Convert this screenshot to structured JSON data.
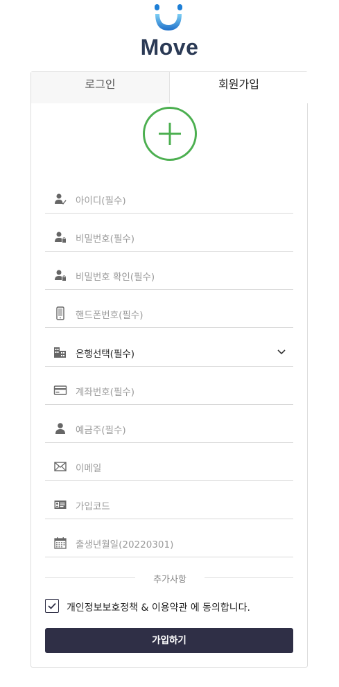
{
  "brand": {
    "name": "Move"
  },
  "tabs": [
    {
      "label": "로그인",
      "active": false
    },
    {
      "label": "회원가입",
      "active": true
    }
  ],
  "avatar_upload": {
    "icon": "plus-icon",
    "color": "#4caf50"
  },
  "fields": [
    {
      "id": "user-id",
      "icon": "user-check-icon",
      "placeholder": "아이디(필수)"
    },
    {
      "id": "password",
      "icon": "user-lock-icon",
      "placeholder": "비밀번호(필수)"
    },
    {
      "id": "password-confirm",
      "icon": "user-lock-icon",
      "placeholder": "비밀번호 확인(필수)"
    },
    {
      "id": "phone",
      "icon": "smartphone-icon",
      "placeholder": "핸드폰번호(필수)"
    },
    {
      "id": "bank",
      "icon": "building-icon",
      "value": "은행선택(필수)",
      "type": "select"
    },
    {
      "id": "account-number",
      "icon": "credit-card-icon",
      "placeholder": "계좌번호(필수)"
    },
    {
      "id": "account-holder",
      "icon": "user-icon",
      "placeholder": "예금주(필수)"
    },
    {
      "id": "email",
      "icon": "envelope-icon",
      "placeholder": "이메일"
    },
    {
      "id": "signup-code",
      "icon": "id-card-icon",
      "placeholder": "가입코드"
    },
    {
      "id": "birthdate",
      "icon": "calendar-icon",
      "placeholder": "출생년월일(20220301)"
    }
  ],
  "section": {
    "extra_label": "추가사항"
  },
  "agreement": {
    "label": "개인정보보호정책 & 이용약관 에 동의합니다.",
    "checked": true
  },
  "submit": {
    "label": "가입하기"
  },
  "colors": {
    "accent": "#4caf50",
    "primary_button": "#2f2f46",
    "brand_text": "#2b3a55",
    "logo_blue": "#1e88d4"
  }
}
